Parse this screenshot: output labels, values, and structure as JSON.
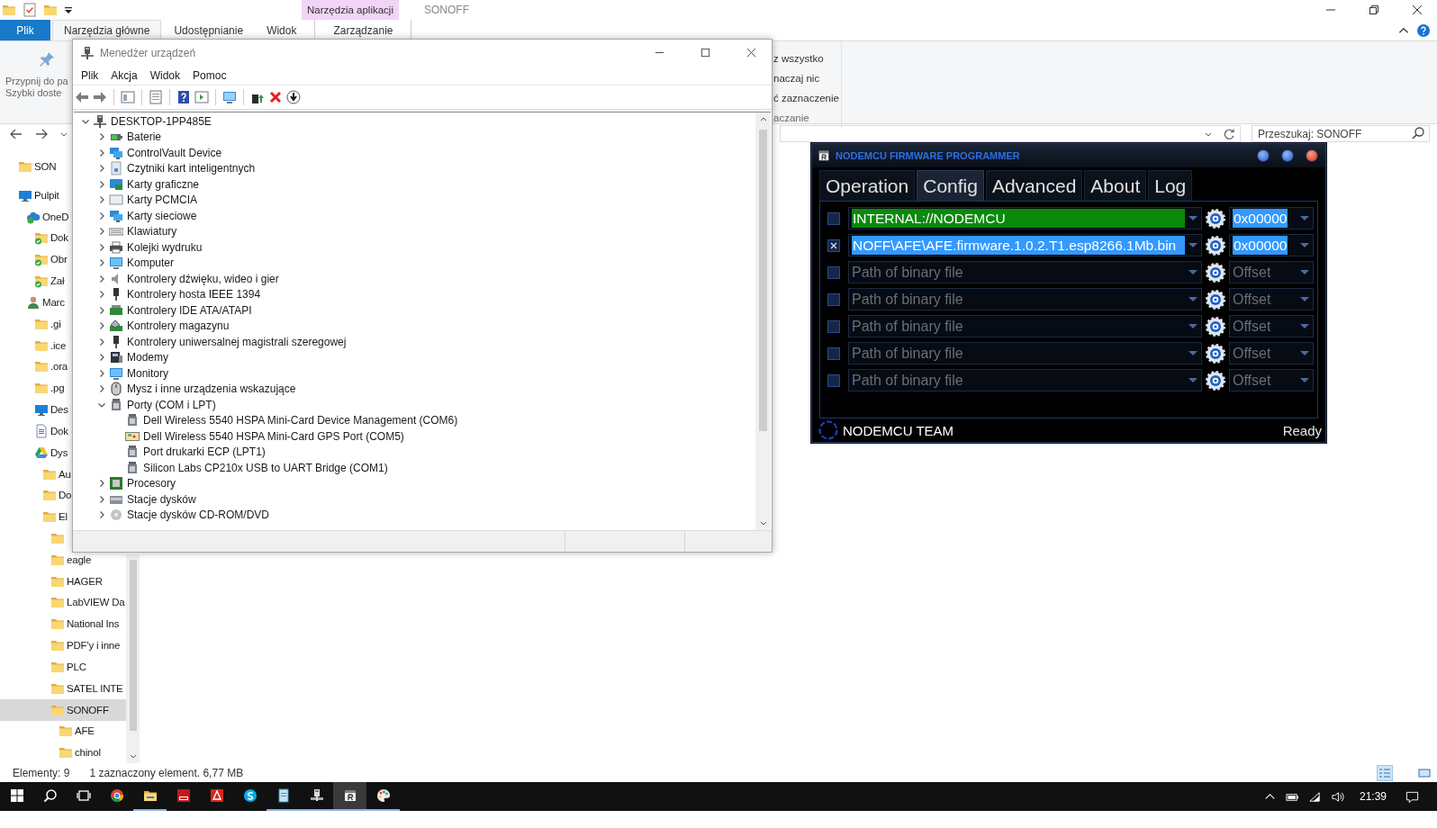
{
  "explorer": {
    "title": "SONOFF",
    "context_group": "Narzędzia aplikacji",
    "tabs": [
      {
        "label": "Plik",
        "kind": "file",
        "selected": false
      },
      {
        "label": "Narzędzia główne",
        "kind": "tab",
        "selected": true
      },
      {
        "label": "Udostępnianie",
        "kind": "tab",
        "selected": false
      },
      {
        "label": "Widok",
        "kind": "tab",
        "selected": false
      },
      {
        "label": "Zarządzanie",
        "kind": "context",
        "selected": false
      }
    ],
    "ribbon_left": [
      "Przypnij do pa",
      "Szybki doste"
    ],
    "ribbon_right": [
      "z wszystko",
      "naczaj nic",
      "ć zaznaczenie",
      "aczanie"
    ],
    "search": {
      "placeholder": "Przeszukaj: SONOFF"
    },
    "nav": [
      {
        "label": "SON",
        "kind": "folder",
        "selected": false
      },
      {
        "label": "Pulpit",
        "kind": "desktop",
        "selected": false,
        "children": [
          {
            "label": "OneD",
            "kind": "cloud",
            "selected": false,
            "children": [
              {
                "label": "Dok",
                "kind": "synced-folder",
                "selected": false
              },
              {
                "label": "Obr",
                "kind": "synced-folder",
                "selected": false
              },
              {
                "label": "Zał",
                "kind": "synced-folder",
                "selected": false
              }
            ]
          },
          {
            "label": "Marc",
            "kind": "user",
            "selected": false,
            "children": [
              {
                "label": ".gi",
                "kind": "folder",
                "selected": false
              },
              {
                "label": ".ice",
                "kind": "folder",
                "selected": false
              },
              {
                "label": ".ora",
                "kind": "folder",
                "selected": false
              },
              {
                "label": ".pg",
                "kind": "folder",
                "selected": false
              },
              {
                "label": "Des",
                "kind": "desktop",
                "selected": false
              },
              {
                "label": "Dok",
                "kind": "document",
                "selected": false
              },
              {
                "label": "Dys",
                "kind": "drive",
                "selected": false,
                "children": [
                  {
                    "label": "Au",
                    "kind": "folder",
                    "selected": false
                  },
                  {
                    "label": "Do",
                    "kind": "folder",
                    "selected": false
                  },
                  {
                    "label": "El",
                    "kind": "folder",
                    "selected": false,
                    "children": [
                      {
                        "kind": "folder",
                        "selected": false
                      },
                      {
                        "label": "eagle",
                        "kind": "folder",
                        "selected": false
                      },
                      {
                        "label": "HAGER",
                        "kind": "folder",
                        "selected": false
                      },
                      {
                        "label": "LabVIEW Da",
                        "kind": "folder",
                        "selected": false
                      },
                      {
                        "label": "National Ins",
                        "kind": "folder",
                        "selected": false
                      },
                      {
                        "label": "PDF'y i inne",
                        "kind": "folder",
                        "selected": false
                      },
                      {
                        "label": "PLC",
                        "kind": "folder",
                        "selected": false
                      },
                      {
                        "label": "SATEL INTE",
                        "kind": "folder",
                        "selected": false
                      },
                      {
                        "label": "SONOFF",
                        "kind": "folder",
                        "selected": true,
                        "children": [
                          {
                            "label": "AFE",
                            "kind": "folder",
                            "selected": false
                          },
                          {
                            "label": "chinol",
                            "kind": "folder",
                            "selected": false
                          }
                        ]
                      }
                    ]
                  }
                ]
              }
            ]
          }
        ]
      }
    ],
    "status": [
      "Elementy: 9",
      "1 zaznaczony element. 6,77 MB"
    ]
  },
  "device_manager": {
    "title": "Menedżer urządzeń",
    "menu": [
      "Plik",
      "Akcja",
      "Widok",
      "Pomoc"
    ],
    "tree": [
      {
        "label": "DESKTOP-1PP485E",
        "kind": "computer",
        "expanded": true,
        "children": [
          {
            "label": "Baterie",
            "kind": "battery",
            "expanded": false
          },
          {
            "label": "ControlVault Device",
            "kind": "network",
            "expanded": false
          },
          {
            "label": "Czytniki kart inteligentnych",
            "kind": "card-reader",
            "expanded": false
          },
          {
            "label": "Karty graficzne",
            "kind": "display",
            "expanded": false
          },
          {
            "label": "Karty PCMCIA",
            "kind": "pcmcia",
            "expanded": false
          },
          {
            "label": "Karty sieciowe",
            "kind": "network",
            "expanded": false
          },
          {
            "label": "Klawiatury",
            "kind": "keyboard",
            "expanded": false
          },
          {
            "label": "Kolejki wydruku",
            "kind": "printer",
            "expanded": false
          },
          {
            "label": "Komputer",
            "kind": "monitor",
            "expanded": false
          },
          {
            "label": "Kontrolery dźwięku, wideo i gier",
            "kind": "speaker",
            "expanded": false
          },
          {
            "label": "Kontrolery hosta IEEE 1394",
            "kind": "usb",
            "expanded": false
          },
          {
            "label": "Kontrolery IDE ATA/ATAPI",
            "kind": "ide",
            "expanded": false
          },
          {
            "label": "Kontrolery magazynu",
            "kind": "storage",
            "expanded": false
          },
          {
            "label": "Kontrolery uniwersalnej magistrali szeregowej",
            "kind": "usb",
            "expanded": false
          },
          {
            "label": "Modemy",
            "kind": "modem",
            "expanded": false
          },
          {
            "label": "Monitory",
            "kind": "monitor",
            "expanded": false
          },
          {
            "label": "Mysz i inne urządzenia wskazujące",
            "kind": "mouse",
            "expanded": false
          },
          {
            "label": "Porty (COM i LPT)",
            "kind": "port",
            "expanded": true,
            "children": [
              {
                "label": "Dell Wireless 5540 HSPA Mini-Card Device Management (COM6)",
                "kind": "port"
              },
              {
                "label": "Dell Wireless 5540 HSPA Mini-Card GPS Port (COM5)",
                "kind": "gps"
              },
              {
                "label": "Port drukarki ECP (LPT1)",
                "kind": "port"
              },
              {
                "label": "Silicon Labs CP210x USB to UART Bridge (COM1)",
                "kind": "port"
              }
            ]
          },
          {
            "label": "Procesory",
            "kind": "cpu",
            "expanded": false
          },
          {
            "label": "Stacje dysków",
            "kind": "disk",
            "expanded": false
          },
          {
            "label": "Stacje dysków CD-ROM/DVD",
            "kind": "disc",
            "expanded": false
          }
        ]
      }
    ]
  },
  "programmer": {
    "title": "NODEMCU FIRMWARE PROGRAMMER",
    "tabs": [
      {
        "label": "Operation",
        "selected": false
      },
      {
        "label": "Config",
        "selected": true
      },
      {
        "label": "Advanced",
        "selected": false
      },
      {
        "label": "About",
        "selected": false
      },
      {
        "label": "Log",
        "selected": false
      }
    ],
    "rows": [
      {
        "kind": "internal",
        "checked": false,
        "path": "INTERNAL://NODEMCU",
        "offset": "0x00000"
      },
      {
        "kind": "file",
        "checked": true,
        "path": "NOFF\\AFE\\AFE.firmware.1.0.2.T1.esp8266.1Mb.bin",
        "offset": "0x00000"
      },
      {
        "kind": "empty",
        "checked": false,
        "placeholder": "Path of binary file",
        "offset_placeholder": "Offset"
      },
      {
        "kind": "empty",
        "checked": false,
        "placeholder": "Path of binary file",
        "offset_placeholder": "Offset"
      },
      {
        "kind": "empty",
        "checked": false,
        "placeholder": "Path of binary file",
        "offset_placeholder": "Offset"
      },
      {
        "kind": "empty",
        "checked": false,
        "placeholder": "Path of binary file",
        "offset_placeholder": "Offset"
      },
      {
        "kind": "empty",
        "checked": false,
        "placeholder": "Path of binary file",
        "offset_placeholder": "Offset"
      }
    ],
    "team": "NODEMCU TEAM",
    "status": "Ready"
  },
  "taskbar": {
    "apps": [
      {
        "kind": "start",
        "running": false,
        "selected": false
      },
      {
        "kind": "search",
        "running": false,
        "selected": false
      },
      {
        "kind": "taskview",
        "running": false,
        "selected": false
      },
      {
        "kind": "browser",
        "running": false,
        "selected": false
      },
      {
        "kind": "explorer",
        "running": true,
        "selected": false
      },
      {
        "kind": "cad",
        "running": false,
        "selected": false
      },
      {
        "kind": "reader",
        "running": false,
        "selected": false
      },
      {
        "kind": "chat",
        "running": false,
        "selected": false
      },
      {
        "kind": "notepad",
        "running": true,
        "selected": false
      },
      {
        "kind": "devices",
        "running": true,
        "selected": false
      },
      {
        "kind": "programmer",
        "running": true,
        "selected": true
      },
      {
        "kind": "paint",
        "running": true,
        "selected": false
      }
    ],
    "time": "21:39"
  }
}
